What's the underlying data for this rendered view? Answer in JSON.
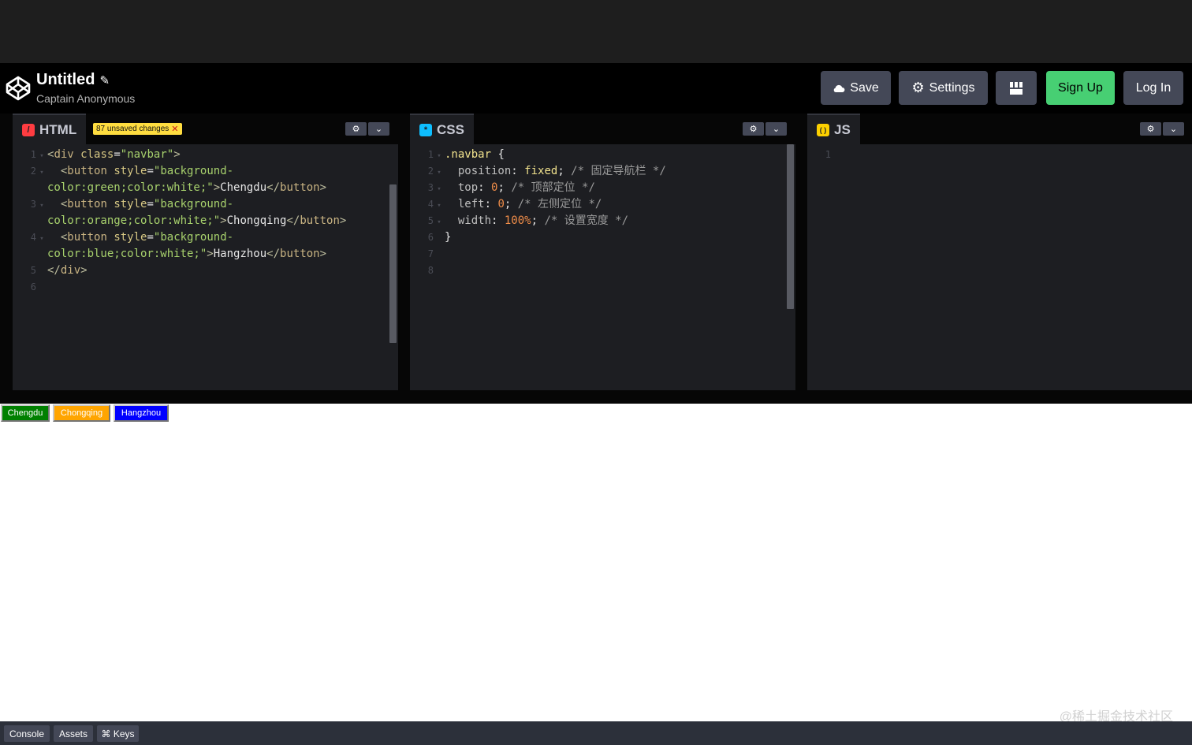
{
  "header": {
    "title": "Untitled",
    "author": "Captain Anonymous",
    "buttons": {
      "save": "Save",
      "settings": "Settings",
      "signup": "Sign Up",
      "login": "Log In"
    }
  },
  "panels": {
    "html": {
      "label": "HTML",
      "badge": "87 unsaved changes",
      "icon_char": "/",
      "icon_color": "#ff3c41"
    },
    "css": {
      "label": "CSS",
      "icon_char": "*",
      "icon_color": "#0ebeff"
    },
    "js": {
      "label": "JS",
      "icon_char": "( )",
      "icon_color": "#fcd000"
    }
  },
  "html_code": [
    {
      "n": "1",
      "fold": true,
      "parts": [
        [
          "tag",
          "<"
        ],
        [
          "tagname",
          "div"
        ],
        [
          "txt",
          " "
        ],
        [
          "attr",
          "class"
        ],
        [
          "txt",
          "="
        ],
        [
          "str",
          "\"navbar\""
        ],
        [
          "tag",
          ">"
        ]
      ]
    },
    {
      "n": "2",
      "fold": true,
      "parts": [
        [
          "txt",
          "  "
        ],
        [
          "tag",
          "<"
        ],
        [
          "tagname",
          "button"
        ],
        [
          "txt",
          " "
        ],
        [
          "attr",
          "style"
        ],
        [
          "txt",
          "="
        ],
        [
          "str",
          "\"background-"
        ]
      ]
    },
    {
      "n": "",
      "fold": false,
      "parts": [
        [
          "str",
          "color:green;color:white;\""
        ],
        [
          "tag",
          ">"
        ],
        [
          "txt",
          "Chengdu"
        ],
        [
          "tag",
          "</"
        ],
        [
          "tagname",
          "button"
        ],
        [
          "tag",
          ">"
        ]
      ]
    },
    {
      "n": "3",
      "fold": true,
      "parts": [
        [
          "txt",
          "  "
        ],
        [
          "tag",
          "<"
        ],
        [
          "tagname",
          "button"
        ],
        [
          "txt",
          " "
        ],
        [
          "attr",
          "style"
        ],
        [
          "txt",
          "="
        ],
        [
          "str",
          "\"background-"
        ]
      ]
    },
    {
      "n": "",
      "fold": false,
      "parts": [
        [
          "str",
          "color:orange;color:white;\""
        ],
        [
          "tag",
          ">"
        ],
        [
          "txt",
          "Chongqing"
        ],
        [
          "tag",
          "</"
        ],
        [
          "tagname",
          "button"
        ],
        [
          "tag",
          ">"
        ]
      ]
    },
    {
      "n": "4",
      "fold": true,
      "parts": [
        [
          "txt",
          "  "
        ],
        [
          "tag",
          "<"
        ],
        [
          "tagname",
          "button"
        ],
        [
          "txt",
          " "
        ],
        [
          "attr",
          "style"
        ],
        [
          "txt",
          "="
        ],
        [
          "str",
          "\"background-"
        ]
      ]
    },
    {
      "n": "",
      "fold": false,
      "parts": [
        [
          "str",
          "color:blue;color:white;\""
        ],
        [
          "tag",
          ">"
        ],
        [
          "txt",
          "Hangzhou"
        ],
        [
          "tag",
          "</"
        ],
        [
          "tagname",
          "button"
        ],
        [
          "tag",
          ">"
        ]
      ]
    },
    {
      "n": "5",
      "fold": false,
      "parts": [
        [
          "tag",
          "</"
        ],
        [
          "tagname",
          "div"
        ],
        [
          "tag",
          ">"
        ]
      ]
    },
    {
      "n": "6",
      "fold": false,
      "parts": []
    }
  ],
  "css_code": [
    {
      "n": "1",
      "fold": true,
      "parts": [
        [
          "sel",
          ".navbar"
        ],
        [
          "txt",
          " {"
        ]
      ]
    },
    {
      "n": "2",
      "fold": true,
      "parts": [
        [
          "txt",
          "  "
        ],
        [
          "prop",
          "position"
        ],
        [
          "txt",
          ": "
        ],
        [
          "val",
          "fixed"
        ],
        [
          "txt",
          "; "
        ],
        [
          "cmt",
          "/* 固定导航栏 */"
        ]
      ]
    },
    {
      "n": "3",
      "fold": true,
      "parts": [
        [
          "txt",
          "  "
        ],
        [
          "prop",
          "top"
        ],
        [
          "txt",
          ": "
        ],
        [
          "num",
          "0"
        ],
        [
          "txt",
          "; "
        ],
        [
          "cmt",
          "/* 顶部定位 */"
        ]
      ]
    },
    {
      "n": "4",
      "fold": true,
      "parts": [
        [
          "txt",
          "  "
        ],
        [
          "prop",
          "left"
        ],
        [
          "txt",
          ": "
        ],
        [
          "num",
          "0"
        ],
        [
          "txt",
          "; "
        ],
        [
          "cmt",
          "/* 左侧定位 */"
        ]
      ]
    },
    {
      "n": "5",
      "fold": true,
      "parts": [
        [
          "txt",
          "  "
        ],
        [
          "prop",
          "width"
        ],
        [
          "txt",
          ": "
        ],
        [
          "num",
          "100%"
        ],
        [
          "txt",
          "; "
        ],
        [
          "cmt",
          "/* 设置宽度 */"
        ]
      ]
    },
    {
      "n": "6",
      "fold": false,
      "parts": [
        [
          "txt",
          "}"
        ]
      ]
    },
    {
      "n": "7",
      "fold": false,
      "parts": []
    },
    {
      "n": "8",
      "fold": false,
      "parts": []
    }
  ],
  "js_code": [
    {
      "n": "1",
      "fold": false,
      "parts": []
    }
  ],
  "preview": {
    "buttons": [
      {
        "label": "Chengdu",
        "bg": "green"
      },
      {
        "label": "Chongqing",
        "bg": "orange"
      },
      {
        "label": "Hangzhou",
        "bg": "blue"
      }
    ],
    "watermark": "@稀土掘金技术社区"
  },
  "bottom": {
    "console": "Console",
    "assets": "Assets",
    "keys": "⌘ Keys"
  }
}
